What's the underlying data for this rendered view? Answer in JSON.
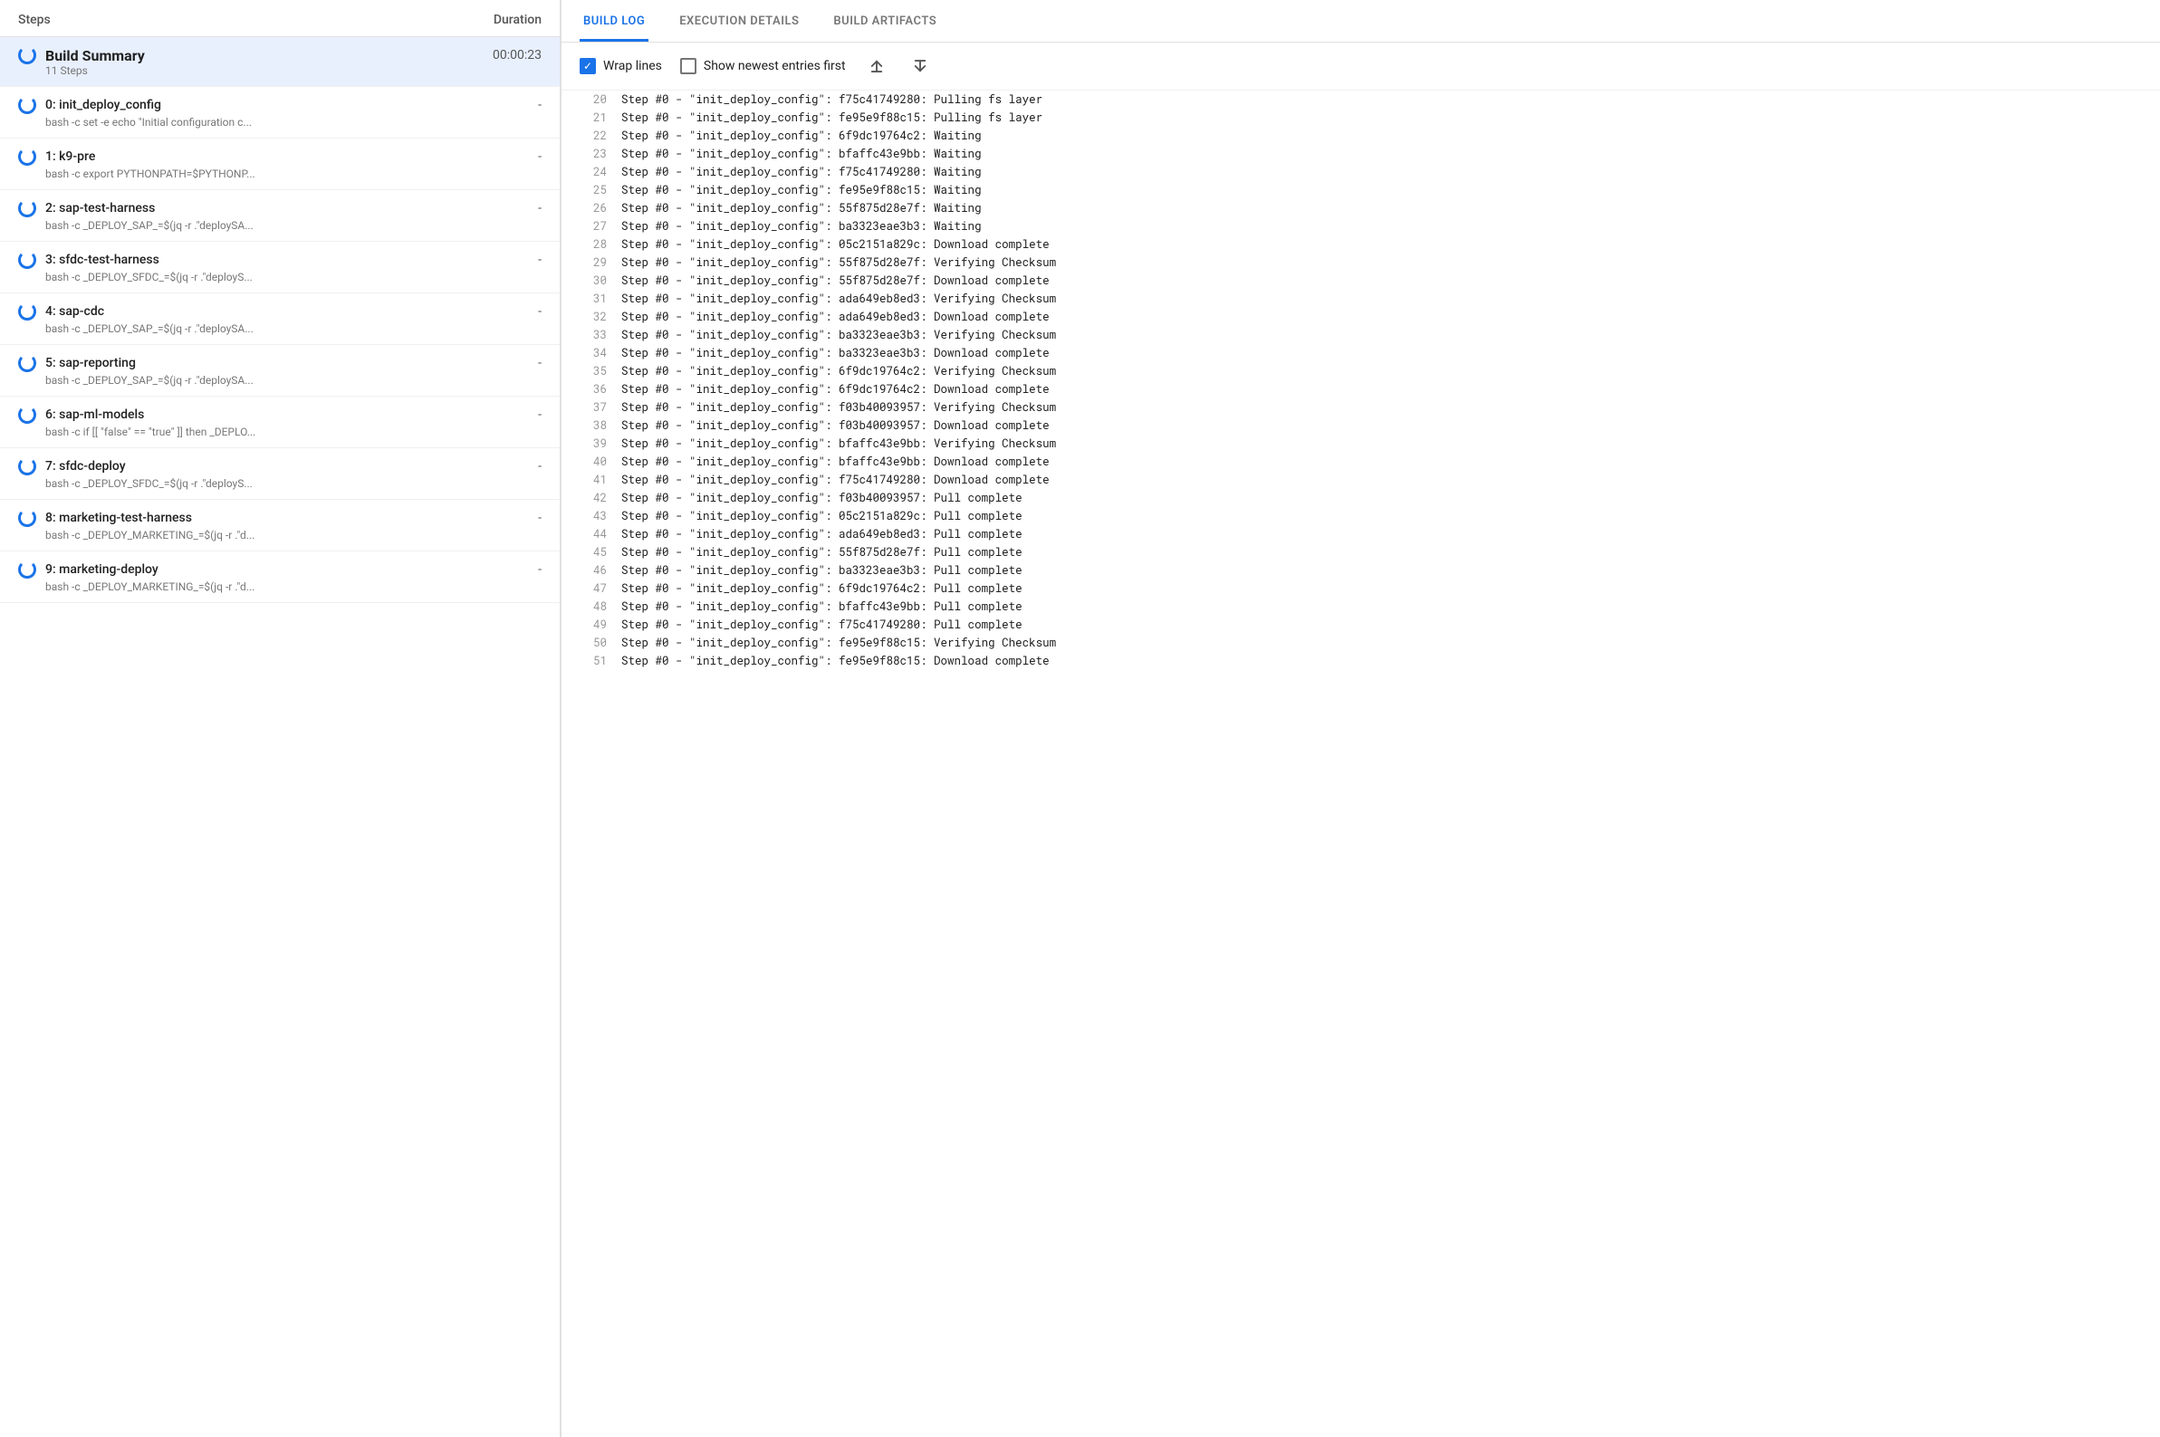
{
  "left_panel": {
    "header": {
      "steps_label": "Steps",
      "duration_label": "Duration"
    },
    "build_summary": {
      "name": "Build Summary",
      "sub_label": "11 Steps",
      "duration": "00:00:23",
      "active": true
    },
    "steps": [
      {
        "id": 0,
        "name": "0: init_deploy_config",
        "subtitle": "bash -c set -e echo \"Initial configuration c...",
        "duration": "-"
      },
      {
        "id": 1,
        "name": "1: k9-pre",
        "subtitle": "bash -c export PYTHONPATH=$PYTHONP...",
        "duration": "-"
      },
      {
        "id": 2,
        "name": "2: sap-test-harness",
        "subtitle": "bash -c _DEPLOY_SAP_=$(jq -r .\"deploySA...",
        "duration": "-"
      },
      {
        "id": 3,
        "name": "3: sfdc-test-harness",
        "subtitle": "bash -c _DEPLOY_SFDC_=$(jq -r .\"deployS...",
        "duration": "-"
      },
      {
        "id": 4,
        "name": "4: sap-cdc",
        "subtitle": "bash -c _DEPLOY_SAP_=$(jq -r .\"deploySA...",
        "duration": "-"
      },
      {
        "id": 5,
        "name": "5: sap-reporting",
        "subtitle": "bash -c _DEPLOY_SAP_=$(jq -r .\"deploySA...",
        "duration": "-"
      },
      {
        "id": 6,
        "name": "6: sap-ml-models",
        "subtitle": "bash -c if [[ \"false\" == \"true\" ]] then _DEPLO...",
        "duration": "-"
      },
      {
        "id": 7,
        "name": "7: sfdc-deploy",
        "subtitle": "bash -c _DEPLOY_SFDC_=$(jq -r .\"deployS...",
        "duration": "-"
      },
      {
        "id": 8,
        "name": "8: marketing-test-harness",
        "subtitle": "bash -c _DEPLOY_MARKETING_=$(jq -r .\"d...",
        "duration": "-"
      },
      {
        "id": 9,
        "name": "9: marketing-deploy",
        "subtitle": "bash -c _DEPLOY_MARKETING_=$(jq -r .\"d...",
        "duration": "-"
      }
    ]
  },
  "right_panel": {
    "tabs": [
      {
        "id": "build-log",
        "label": "BUILD LOG",
        "active": true
      },
      {
        "id": "execution-details",
        "label": "EXECUTION DETAILS",
        "active": false
      },
      {
        "id": "build-artifacts",
        "label": "BUILD ARTIFACTS",
        "active": false
      }
    ],
    "toolbar": {
      "wrap_lines_label": "Wrap lines",
      "wrap_lines_checked": true,
      "show_newest_label": "Show newest entries first",
      "show_newest_checked": false,
      "scroll_top_icon": "↑",
      "scroll_bottom_icon": "↓"
    },
    "log_lines": [
      {
        "num": 20,
        "text": "Step #0 - \"init_deploy_config\": f75c41749280: Pulling fs layer"
      },
      {
        "num": 21,
        "text": "Step #0 - \"init_deploy_config\": fe95e9f88c15: Pulling fs layer"
      },
      {
        "num": 22,
        "text": "Step #0 - \"init_deploy_config\": 6f9dc19764c2: Waiting"
      },
      {
        "num": 23,
        "text": "Step #0 - \"init_deploy_config\": bfaffc43e9bb: Waiting"
      },
      {
        "num": 24,
        "text": "Step #0 - \"init_deploy_config\": f75c41749280: Waiting"
      },
      {
        "num": 25,
        "text": "Step #0 - \"init_deploy_config\": fe95e9f88c15: Waiting"
      },
      {
        "num": 26,
        "text": "Step #0 - \"init_deploy_config\": 55f875d28e7f: Waiting"
      },
      {
        "num": 27,
        "text": "Step #0 - \"init_deploy_config\": ba3323eae3b3: Waiting"
      },
      {
        "num": 28,
        "text": "Step #0 - \"init_deploy_config\": 05c2151a829c: Download complete"
      },
      {
        "num": 29,
        "text": "Step #0 - \"init_deploy_config\": 55f875d28e7f: Verifying Checksum"
      },
      {
        "num": 30,
        "text": "Step #0 - \"init_deploy_config\": 55f875d28e7f: Download complete"
      },
      {
        "num": 31,
        "text": "Step #0 - \"init_deploy_config\": ada649eb8ed3: Verifying Checksum"
      },
      {
        "num": 32,
        "text": "Step #0 - \"init_deploy_config\": ada649eb8ed3: Download complete"
      },
      {
        "num": 33,
        "text": "Step #0 - \"init_deploy_config\": ba3323eae3b3: Verifying Checksum"
      },
      {
        "num": 34,
        "text": "Step #0 - \"init_deploy_config\": ba3323eae3b3: Download complete"
      },
      {
        "num": 35,
        "text": "Step #0 - \"init_deploy_config\": 6f9dc19764c2: Verifying Checksum"
      },
      {
        "num": 36,
        "text": "Step #0 - \"init_deploy_config\": 6f9dc19764c2: Download complete"
      },
      {
        "num": 37,
        "text": "Step #0 - \"init_deploy_config\": f03b40093957: Verifying Checksum"
      },
      {
        "num": 38,
        "text": "Step #0 - \"init_deploy_config\": f03b40093957: Download complete"
      },
      {
        "num": 39,
        "text": "Step #0 - \"init_deploy_config\": bfaffc43e9bb: Verifying Checksum"
      },
      {
        "num": 40,
        "text": "Step #0 - \"init_deploy_config\": bfaffc43e9bb: Download complete"
      },
      {
        "num": 41,
        "text": "Step #0 - \"init_deploy_config\": f75c41749280: Download complete"
      },
      {
        "num": 42,
        "text": "Step #0 - \"init_deploy_config\": f03b40093957: Pull complete"
      },
      {
        "num": 43,
        "text": "Step #0 - \"init_deploy_config\": 05c2151a829c: Pull complete"
      },
      {
        "num": 44,
        "text": "Step #0 - \"init_deploy_config\": ada649eb8ed3: Pull complete"
      },
      {
        "num": 45,
        "text": "Step #0 - \"init_deploy_config\": 55f875d28e7f: Pull complete"
      },
      {
        "num": 46,
        "text": "Step #0 - \"init_deploy_config\": ba3323eae3b3: Pull complete"
      },
      {
        "num": 47,
        "text": "Step #0 - \"init_deploy_config\": 6f9dc19764c2: Pull complete"
      },
      {
        "num": 48,
        "text": "Step #0 - \"init_deploy_config\": bfaffc43e9bb: Pull complete"
      },
      {
        "num": 49,
        "text": "Step #0 - \"init_deploy_config\": f75c41749280: Pull complete"
      },
      {
        "num": 50,
        "text": "Step #0 - \"init_deploy_config\": fe95e9f88c15: Verifying Checksum"
      },
      {
        "num": 51,
        "text": "Step #0 - \"init_deploy_config\": fe95e9f88c15: Download complete"
      }
    ]
  }
}
